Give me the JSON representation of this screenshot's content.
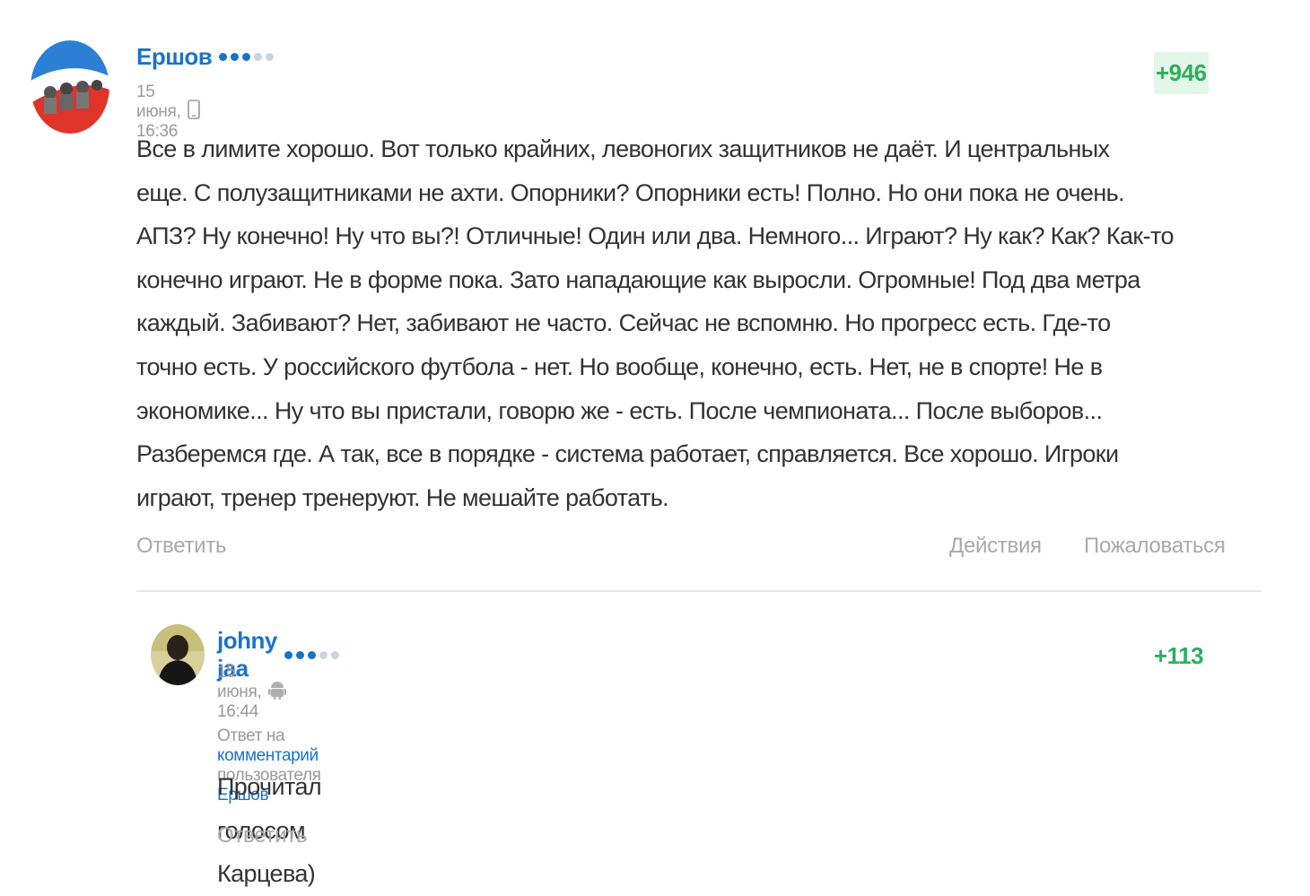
{
  "comments": [
    {
      "author": "Ершов",
      "level_dots": [
        true,
        true,
        true,
        false,
        false
      ],
      "date": "15 июня, 16:36",
      "device_icon": "phone-icon",
      "rating": "+946",
      "text_lines": [
        "Все в лимите хорошо. Вот только крайних, левоногих защитников не даёт. И центральных",
        "еще. С полузащитниками не ахти. Опорники? Опорники есть! Полно. Но они пока не очень.",
        "АПЗ? Ну конечно! Ну что вы?! Отличные! Один или два. Немного... Играют? Ну как? Как? Как-то",
        "конечно играют. Не в форме пока. Зато нападающие как выросли. Огромные! Под два метра",
        "каждый. Забивают? Нет, забивают не часто. Сейчас не вспомню. Но прогресс есть. Где-то",
        "точно есть. У российского футбола - нет. Но вообще, конечно, есть. Нет, не в спорте! Не в",
        "экономике... Ну что вы пристали, говорю же - есть. После чемпионата... После выборов...",
        "Разберемся где. А так, все в порядке - система работает, справляется. Все хорошо. Игроки",
        "играют, тренер тренеруют. Не мешайте работать."
      ],
      "reply_label": "Ответить",
      "actions_label": "Действия",
      "report_label": "Пожаловаться"
    },
    {
      "author": "johny jaa",
      "level_dots": [
        true,
        true,
        true,
        false,
        false
      ],
      "date": "15 июня, 16:44",
      "device_icon": "android-icon",
      "rating": "+113",
      "reply_to": {
        "prefix": "Ответ на",
        "link": "комментарий",
        "middle": "пользователя",
        "user": "Ершов"
      },
      "text": "Прочитал голосом Карцева)",
      "reply_label": "Ответить"
    }
  ],
  "colors": {
    "link": "#1a73c8",
    "rating": "#2eae5e",
    "rating_bg": "#e3f6e8",
    "muted": "#9a9a9a"
  }
}
